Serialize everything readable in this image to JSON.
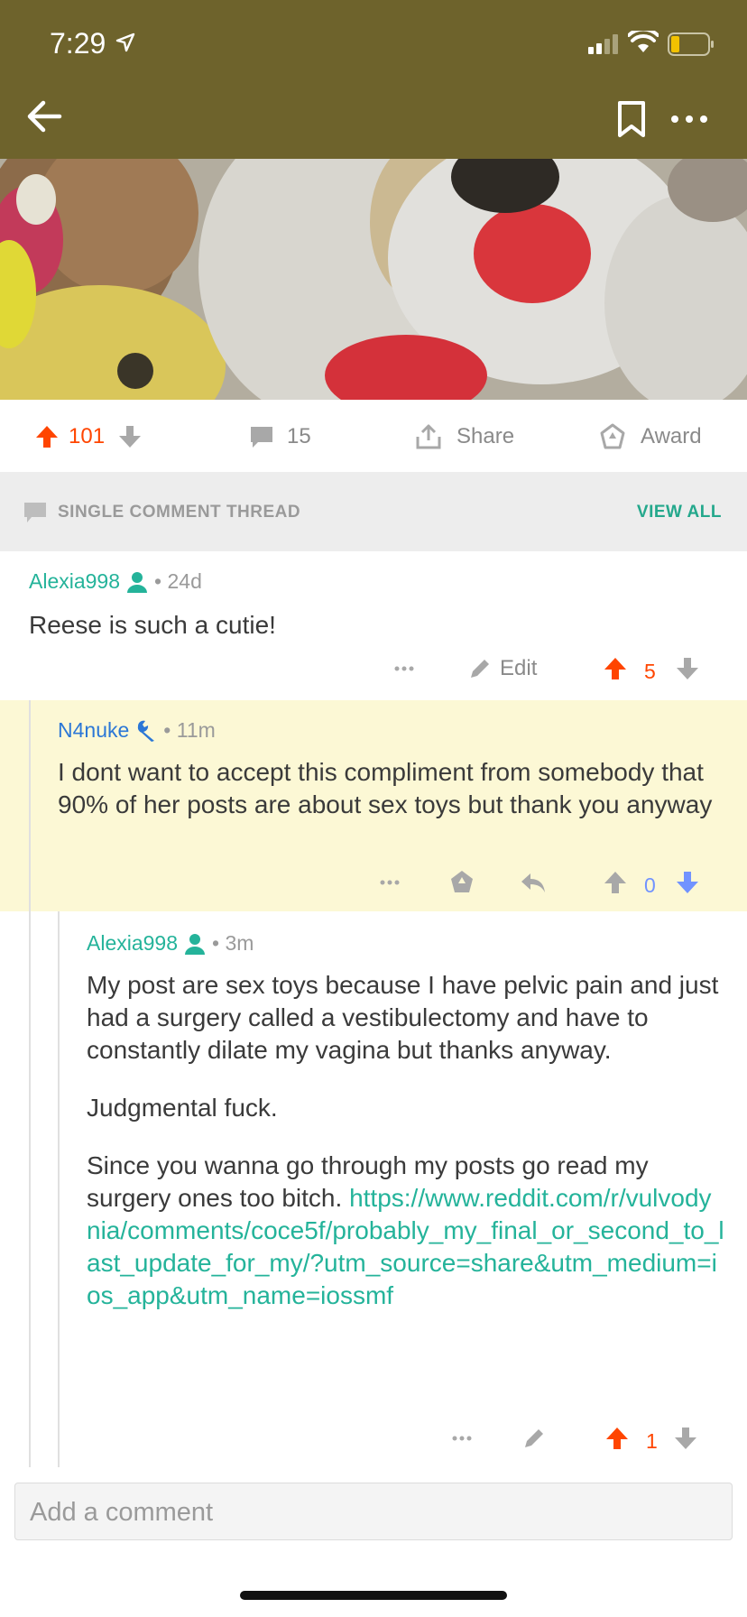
{
  "status_bar": {
    "time": "7:29"
  },
  "colors": {
    "header": "#6e632c",
    "upvote": "#ff4500",
    "downvote": "#7193ff",
    "accent": "#24b39a",
    "mod": "#2b77d6",
    "highlight": "#fcf8d5"
  },
  "icons": {
    "back": "arrow-left",
    "bookmark": "bookmark",
    "more": "ellipsis"
  },
  "post_actions": {
    "score": "101",
    "comments": "15",
    "share": "Share",
    "award": "Award"
  },
  "thread_bar": {
    "label": "SINGLE COMMENT THREAD",
    "view_all": "VIEW ALL"
  },
  "comments": [
    {
      "author": "Alexia998",
      "time": "24d",
      "paragraphs": [
        "Reese is such a cutie!"
      ],
      "edit_label": "Edit",
      "score": "5"
    },
    {
      "author": "N4nuke",
      "time": "11m",
      "paragraphs": [
        "I dont want to accept this compliment from somebody that 90% of her posts are about sex toys but thank you anyway"
      ],
      "score": "0"
    },
    {
      "author": "Alexia998",
      "time": "3m",
      "paragraphs": [
        "My post are sex toys because I have pelvic pain and just had a surgery called a vestibulectomy and have to constantly dilate my vagina but thanks anyway.",
        "Judgmental fuck.",
        "Since you wanna go through my posts go read my surgery ones too bitch."
      ],
      "link": "https://www.reddit.com/r/vulvodynia/comments/coce5f/probably_my_final_or_second_to_last_update_for_my/?utm_source=share&utm_medium=ios_app&utm_name=iossmf",
      "score": "1"
    }
  ],
  "comment_input": {
    "placeholder": "Add a comment"
  }
}
